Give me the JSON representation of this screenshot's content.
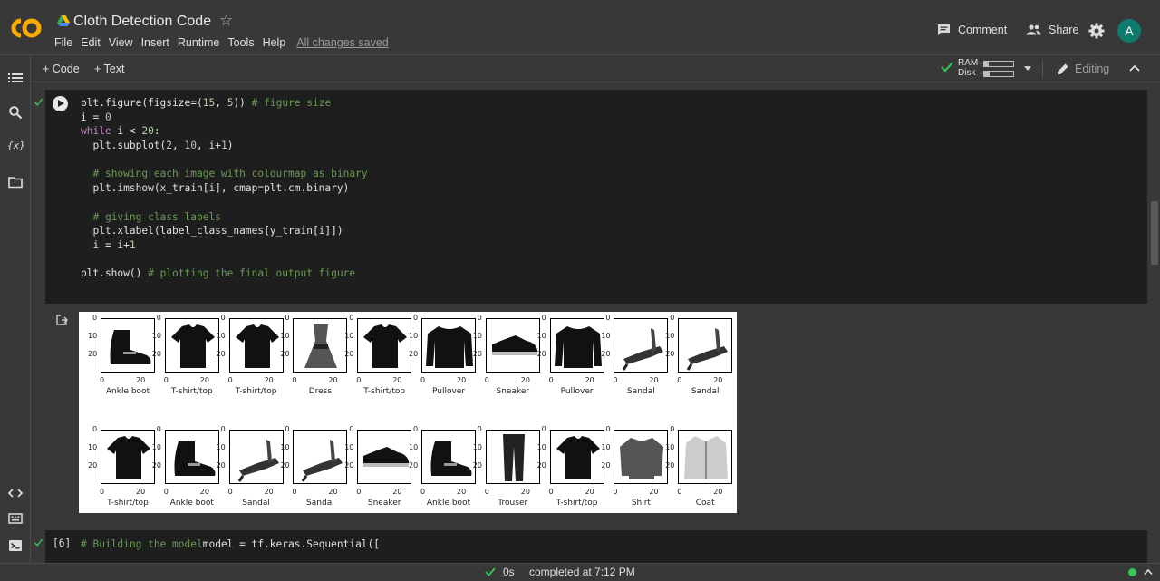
{
  "header": {
    "title": "Cloth Detection Code",
    "menu": [
      "File",
      "Edit",
      "View",
      "Insert",
      "Runtime",
      "Tools",
      "Help"
    ],
    "save_status": "All changes saved",
    "comment_label": "Comment",
    "share_label": "Share",
    "avatar_letter": "A"
  },
  "toolbar": {
    "add_code": "+ Code",
    "add_text": "+ Text",
    "ram_label": "RAM",
    "disk_label": "Disk",
    "ram_usage": 0.15,
    "disk_usage": 0.2,
    "mode_label": "Editing"
  },
  "cell1": {
    "lines": [
      [
        {
          "t": "plt.figure(figsize=(",
          "c": ""
        },
        {
          "t": "15",
          "c": "num"
        },
        {
          "t": ", ",
          "c": ""
        },
        {
          "t": "5",
          "c": "num"
        },
        {
          "t": ")) ",
          "c": ""
        },
        {
          "t": "# figure size",
          "c": "cm"
        }
      ],
      [
        {
          "t": "i = ",
          "c": ""
        },
        {
          "t": "0",
          "c": "num"
        }
      ],
      [
        {
          "t": "while",
          "c": "kw"
        },
        {
          "t": " i < ",
          "c": ""
        },
        {
          "t": "20",
          "c": "num"
        },
        {
          "t": ":",
          "c": ""
        }
      ],
      [
        {
          "t": "  plt.subplot(",
          "c": ""
        },
        {
          "t": "2",
          "c": "num"
        },
        {
          "t": ", ",
          "c": ""
        },
        {
          "t": "10",
          "c": "num"
        },
        {
          "t": ", i+",
          "c": ""
        },
        {
          "t": "1",
          "c": "num"
        },
        {
          "t": ")",
          "c": ""
        }
      ],
      [
        {
          "t": "",
          "c": ""
        }
      ],
      [
        {
          "t": "  ",
          "c": ""
        },
        {
          "t": "# showing each image with colourmap as binary",
          "c": "cm"
        }
      ],
      [
        {
          "t": "  plt.imshow(x_train[i], cmap=plt.cm.binary)",
          "c": ""
        }
      ],
      [
        {
          "t": "",
          "c": ""
        }
      ],
      [
        {
          "t": "  ",
          "c": ""
        },
        {
          "t": "# giving class labels",
          "c": "cm"
        }
      ],
      [
        {
          "t": "  plt.xlabel(label_class_names[y_train[i]])",
          "c": ""
        }
      ],
      [
        {
          "t": "  i = i+",
          "c": ""
        },
        {
          "t": "1",
          "c": "num"
        }
      ],
      [
        {
          "t": "",
          "c": ""
        }
      ],
      [
        {
          "t": "plt.show() ",
          "c": ""
        },
        {
          "t": "# plotting the final output figure",
          "c": "cm"
        }
      ]
    ]
  },
  "figure": {
    "y_ticks": [
      "0",
      "10",
      "20"
    ],
    "x_ticks": [
      "0",
      "20"
    ],
    "labels": [
      "Ankle boot",
      "T-shirt/top",
      "T-shirt/top",
      "Dress",
      "T-shirt/top",
      "Pullover",
      "Sneaker",
      "Pullover",
      "Sandal",
      "Sandal",
      "T-shirt/top",
      "Ankle boot",
      "Sandal",
      "Sandal",
      "Sneaker",
      "Ankle boot",
      "Trouser",
      "T-shirt/top",
      "Shirt",
      "Coat"
    ]
  },
  "cell2": {
    "exec_count": "[6]",
    "lines": [
      [
        {
          "t": "# Building the model",
          "c": "cm"
        }
      ],
      [
        {
          "t": "model = tf.keras.Sequential([",
          "c": ""
        }
      ]
    ]
  },
  "status": {
    "duration": "0s",
    "message": "completed at 7:12 PM"
  }
}
